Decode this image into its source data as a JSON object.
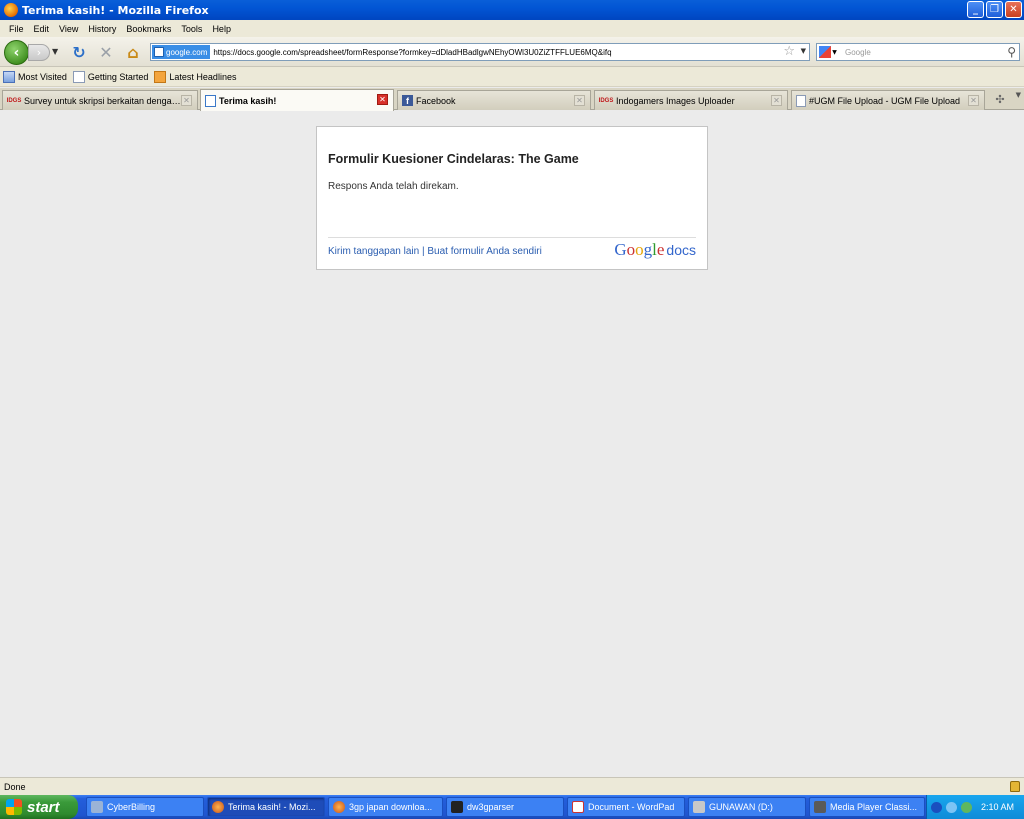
{
  "window": {
    "title": "Terima kasih! - Mozilla Firefox"
  },
  "menu": [
    "File",
    "Edit",
    "View",
    "History",
    "Bookmarks",
    "Tools",
    "Help"
  ],
  "toolbar": {
    "site_identity": "google.com",
    "url": "https://docs.google.com/spreadsheet/formResponse?formkey=dDladHBadlgwNEhyOWl3U0ZiZTFFLUE6MQ&ifq",
    "search_placeholder": "Google"
  },
  "bookmarks": [
    "Most Visited",
    "Getting Started",
    "Latest Headlines"
  ],
  "tabs": [
    {
      "label": "Survey untuk skripsi berkaitan dengan...",
      "icon": "idgs"
    },
    {
      "label": "Terima kasih!",
      "icon": "gdoc"
    },
    {
      "label": "Facebook",
      "icon": "fb"
    },
    {
      "label": "Indogamers Images Uploader",
      "icon": "idgs"
    },
    {
      "label": "#UGM File Upload - UGM File Upload",
      "icon": "page"
    }
  ],
  "form": {
    "title": "Formulir Kuesioner Cindelaras: The Game",
    "message": "Respons Anda telah direkam.",
    "link_submit_another": "Kirim tanggapan lain",
    "separator": "|",
    "link_create_own": "Buat formulir Anda sendiri",
    "logo_google": "Google",
    "logo_docs": "docs"
  },
  "status": {
    "text": "Done"
  },
  "taskbar": {
    "start": "start",
    "tasks": [
      "CyberBilling",
      "Terima kasih! - Mozi...",
      "3gp japan downloa...",
      "dw3gparser",
      "Document - WordPad",
      "GUNAWAN (D:)",
      "Media Player Classi..."
    ],
    "clock": "2:10 AM"
  },
  "colors": {
    "link": "#2a5db0",
    "titlebar": "#0255d4",
    "taskbar": "#245edb",
    "start": "#3a9a3a"
  }
}
